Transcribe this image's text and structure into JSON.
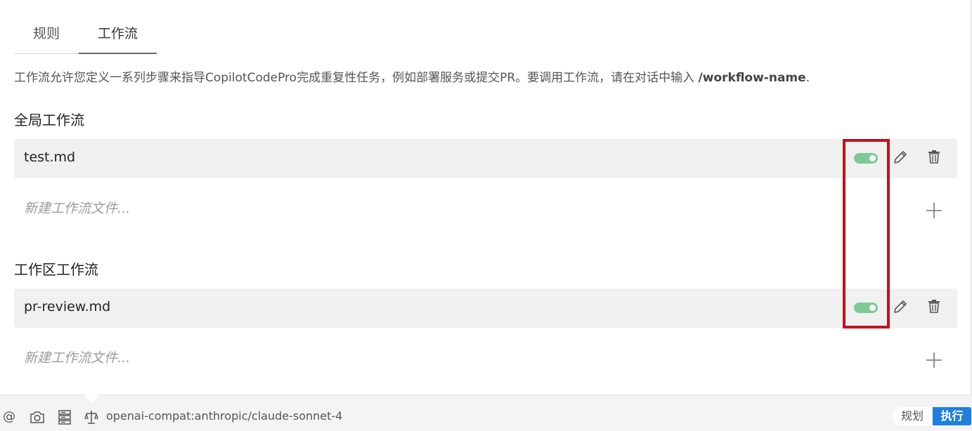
{
  "tabs": [
    {
      "label": "规则",
      "active": false
    },
    {
      "label": "工作流",
      "active": true
    }
  ],
  "description": {
    "text": "工作流允许您定义一系列步骤来指导CopilotCodePro完成重复性任务，例如部署服务或提交PR。要调用工作流，请在对话中输入 ",
    "command": "/workflow-name",
    "suffix": "."
  },
  "global_section": {
    "title": "全局工作流",
    "items": [
      {
        "name": "test.md",
        "enabled": true
      }
    ],
    "new_placeholder": "新建工作流文件..."
  },
  "workspace_section": {
    "title": "工作区工作流",
    "items": [
      {
        "name": "pr-review.md",
        "enabled": true
      }
    ],
    "new_placeholder": "新建工作流文件..."
  },
  "bottom_bar": {
    "icons": [
      "at-icon",
      "camera-icon",
      "server-icon",
      "scale-icon"
    ],
    "at_symbol": "@",
    "model": "openai-compat:anthropic/claude-sonnet-4",
    "mode_plan": "规划",
    "mode_exec": "执行"
  },
  "colors": {
    "toggle_on": "#7ec994",
    "highlight": "#c0121c",
    "accent": "#1f7fe0"
  }
}
